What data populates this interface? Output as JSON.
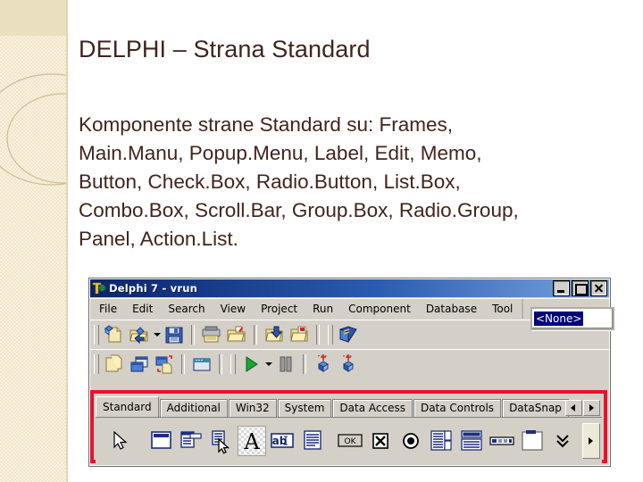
{
  "slide": {
    "title": "DELPHI – Strana Standard",
    "body_lines": [
      "Komponente strane Standard su: Frames,",
      "Main.Manu, Popup.Menu, Label, Edit, Memo,",
      "Button, Check.Box, Radio.Button, List.Box,",
      "Combo.Box, Scroll.Bar, Group.Box, Radio.Group,",
      "Panel, Action.List."
    ],
    "accent_band_color": "#f2e6c9",
    "text_color": "#41241d"
  },
  "delphi_window": {
    "titlebar": {
      "title": "Delphi 7 - vrun",
      "icon": "delphi7-logo-icon",
      "buttons": [
        {
          "name": "minimize-button",
          "label": "_"
        },
        {
          "name": "maximize-button",
          "label": "□"
        },
        {
          "name": "close-button",
          "label": "X"
        }
      ]
    },
    "menubar": {
      "items": [
        "File",
        "Edit",
        "Search",
        "View",
        "Project",
        "Run",
        "Component",
        "Database",
        "Tool"
      ]
    },
    "desktop_combo": {
      "value": "<None>"
    },
    "toolbar_row1": [
      "new-item-icon",
      "open-file-icon",
      "open-dropdown-arrow",
      "save-icon",
      "save-all-icon",
      "open-project-icon",
      "add-to-project-icon",
      "remove-from-project-icon",
      "help-contents-icon"
    ],
    "toolbar_row2": [
      "view-unit-icon",
      "view-form-icon",
      "toggle-form-unit-icon",
      "new-form-icon",
      "run-icon",
      "run-dropdown-arrow",
      "pause-icon",
      "trace-into-icon",
      "step-over-icon"
    ],
    "component_palette": {
      "highlight_color": "#e8112d",
      "tabs": [
        "Standard",
        "Additional",
        "Win32",
        "System",
        "Data Access",
        "Data Controls",
        "DataSnap"
      ],
      "active_tab": "Standard",
      "tab_scroll_left": "scroll-left-arrow-icon",
      "tab_scroll_right": "scroll-right-arrow-icon",
      "components": [
        "pointer-tool-icon",
        "frames-icon",
        "mainmenu-icon",
        "popupmenu-icon",
        "label-icon",
        "edit-icon",
        "memo-icon",
        "button-icon",
        "checkbox-icon",
        "radiobutton-icon",
        "listbox-icon",
        "combobox-icon",
        "scrollbar-icon",
        "groupbox-icon",
        "radiogroup-icon"
      ],
      "selected_component": "label-icon",
      "cursor_over": "popupmenu-icon",
      "palette_scroll_right": "palette-scroll-right-icon"
    }
  }
}
